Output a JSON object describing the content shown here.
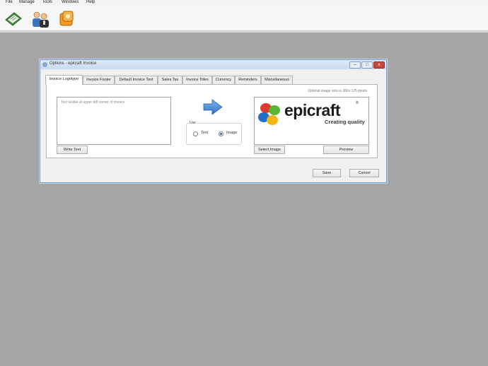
{
  "menu": [
    "File",
    "Manage",
    "Tools",
    "Windows",
    "Help"
  ],
  "toolbar": {
    "icons": [
      "invoice-book-icon",
      "users-icon",
      "settings-cube-icon"
    ]
  },
  "dialog": {
    "title": "Options - epicraft Invoice",
    "window_buttons": {
      "minimize": "–",
      "maximize": "□",
      "close": "x"
    },
    "tabs": [
      "Invoice Logotype",
      "Invoice Footer",
      "Default Invoice Text",
      "Sales Tax",
      "Invoice Titles",
      "Currency",
      "Reminders",
      "Miscellaneous"
    ],
    "active_tab": "Invoice Logotype",
    "hint": "Optimal image size is 380x 125 pixels",
    "text_placeholder": "Text visible at upper left corner of invoice",
    "write_text_label": "Write Text",
    "use_label": "Use",
    "radio_text_label": "Text",
    "radio_image_label": "Image",
    "selected_source": "Image",
    "logo": {
      "name": "epicraft",
      "reg": "®",
      "tagline": "Creating quality"
    },
    "select_image_label": "Select Image",
    "preview_label": "Preview",
    "save_label": "Save",
    "cancel_label": "Cancel"
  },
  "colors": {
    "desktop": "#a6a6a6",
    "arrow": "#4a8fd9",
    "logo_red": "#e03a2f",
    "logo_green": "#5bb531",
    "logo_blue": "#1f6fc9",
    "logo_yellow": "#f2b417"
  }
}
